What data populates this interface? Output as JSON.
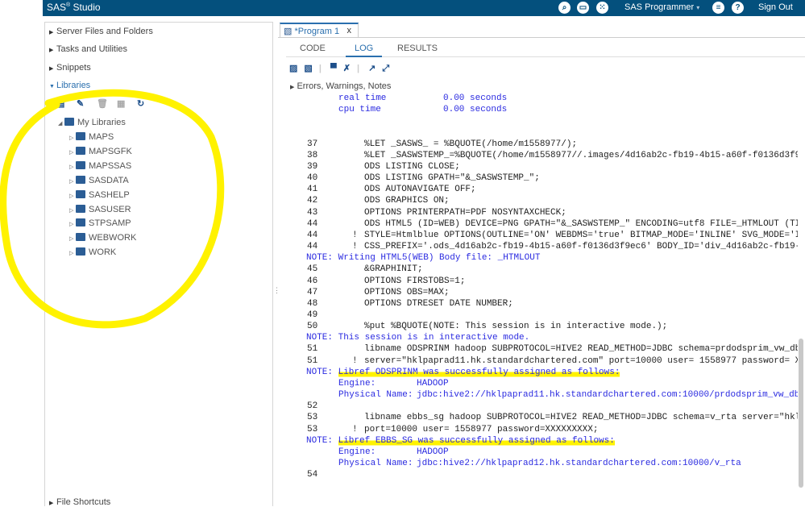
{
  "header": {
    "app_title": "SAS",
    "app_title_sup": "®",
    "app_title_rest": "Studio",
    "role": "SAS Programmer",
    "signout": "Sign Out"
  },
  "left": {
    "sections": [
      "Server Files and Folders",
      "Tasks and Utilities",
      "Snippets",
      "Libraries"
    ],
    "my_libraries": "My Libraries",
    "libraries": [
      "MAPS",
      "MAPSGFK",
      "MAPSSAS",
      "SASDATA",
      "SASHELP",
      "SASUSER",
      "STPSAMP",
      "WEBWORK",
      "WORK"
    ],
    "file_shortcuts": "File Shortcuts"
  },
  "editor": {
    "tab_label": "*Program 1",
    "close": "x",
    "subtabs": [
      "CODE",
      "LOG",
      "RESULTS"
    ],
    "active_subtab": "LOG",
    "errors_label": "Errors, Warnings, Notes"
  },
  "log": [
    {
      "t": "info",
      "label": "real time",
      "value": "0.00 seconds"
    },
    {
      "t": "info",
      "label": "cpu time",
      "value": "0.00 seconds"
    },
    {
      "t": "blank"
    },
    {
      "t": "blank"
    },
    {
      "t": "code",
      "n": "37",
      "text": "%LET _SASWS_ = %BQUOTE(/home/m1558977/);"
    },
    {
      "t": "code",
      "n": "38",
      "text": "%LET _SASWSTEMP_=%BQUOTE(/home/m1558977//.images/4d16ab2c-fb19-4b15-a60f-f0136d3f9"
    },
    {
      "t": "code",
      "n": "39",
      "text": "ODS LISTING CLOSE;"
    },
    {
      "t": "code",
      "n": "40",
      "text": "ODS LISTING GPATH=\"&_SASWSTEMP_\";"
    },
    {
      "t": "code",
      "n": "41",
      "text": "ODS AUTONAVIGATE OFF;"
    },
    {
      "t": "code",
      "n": "42",
      "text": "ODS GRAPHICS ON;"
    },
    {
      "t": "code",
      "n": "43",
      "text": "OPTIONS PRINTERPATH=PDF NOSYNTAXCHECK;"
    },
    {
      "t": "code",
      "n": "44",
      "text": "ODS HTML5 (ID=WEB) DEVICE=PNG GPATH=\"&_SASWSTEMP_\" ENCODING=utf8 FILE=_HTMLOUT (TI"
    },
    {
      "t": "code",
      "n": "44",
      "bang": "!",
      "text": "STYLE=Htmlblue OPTIONS(OUTLINE='ON' WEBDMS='true' BITMAP_MODE='INLINE' SVG_MODE='I"
    },
    {
      "t": "code",
      "n": "44",
      "bang": "!",
      "text": "CSS_PREFIX='.ods_4d16ab2c-fb19-4b15-a60f-f0136d3f9ec6' BODY_ID='div_4d16ab2c-fb19-"
    },
    {
      "t": "note",
      "text": "NOTE: Writing HTML5(WEB) Body file: _HTMLOUT"
    },
    {
      "t": "code",
      "n": "45",
      "text": "&GRAPHINIT;"
    },
    {
      "t": "code",
      "n": "46",
      "text": "OPTIONS FIRSTOBS=1;"
    },
    {
      "t": "code",
      "n": "47",
      "text": "OPTIONS OBS=MAX;"
    },
    {
      "t": "code",
      "n": "48",
      "text": "OPTIONS DTRESET DATE NUMBER;"
    },
    {
      "t": "code",
      "n": "49",
      "text": ""
    },
    {
      "t": "code",
      "n": "50",
      "text": "%put %BQUOTE(NOTE: This session is in interactive mode.);"
    },
    {
      "t": "note",
      "text": "NOTE: This session is in interactive mode."
    },
    {
      "t": "code",
      "n": "51",
      "text": "libname ODSPRINM hadoop SUBPROTOCOL=HIVE2 READ_METHOD=JDBC schema=prdodsprim_vw_db"
    },
    {
      "t": "code",
      "n": "51",
      "bang": "!",
      "text": "server=\"hklpaprad11.hk.standardchartered.com\" port=10000 user= 1558977 password= X"
    },
    {
      "t": "note",
      "prefix": "NOTE: ",
      "text": "Libref ODSPRINM was successfully assigned as follows:",
      "hl": true
    },
    {
      "t": "kv",
      "label": "Engine:",
      "value": "HADOOP"
    },
    {
      "t": "kv",
      "label": "Physical Name:",
      "value": "jdbc:hive2://hklpaprad11.hk.standardchartered.com:10000/prdodsprim_vw_db"
    },
    {
      "t": "code",
      "n": "52",
      "text": ""
    },
    {
      "t": "code",
      "n": "53",
      "text": "libname ebbs_sg hadoop SUBPROTOCOL=HIVE2 READ_METHOD=JDBC schema=v_rta server=\"hkl"
    },
    {
      "t": "code",
      "n": "53",
      "bang": "!",
      "text": "port=10000 user= 1558977 password=XXXXXXXXX;"
    },
    {
      "t": "note",
      "prefix": "NOTE: ",
      "text": "Libref EBBS_SG was successfully assigned as follows:",
      "hl": true
    },
    {
      "t": "kv",
      "label": "Engine:",
      "value": "HADOOP"
    },
    {
      "t": "kv",
      "label": "Physical Name:",
      "value": "jdbc:hive2://hklpaprad12.hk.standardchartered.com:10000/v_rta"
    },
    {
      "t": "code",
      "n": "54",
      "text": ""
    }
  ],
  "colors": {
    "header": "#04507d",
    "accent": "#2a6fae",
    "note": "#2a2ae0",
    "highlight": "#fff200"
  }
}
